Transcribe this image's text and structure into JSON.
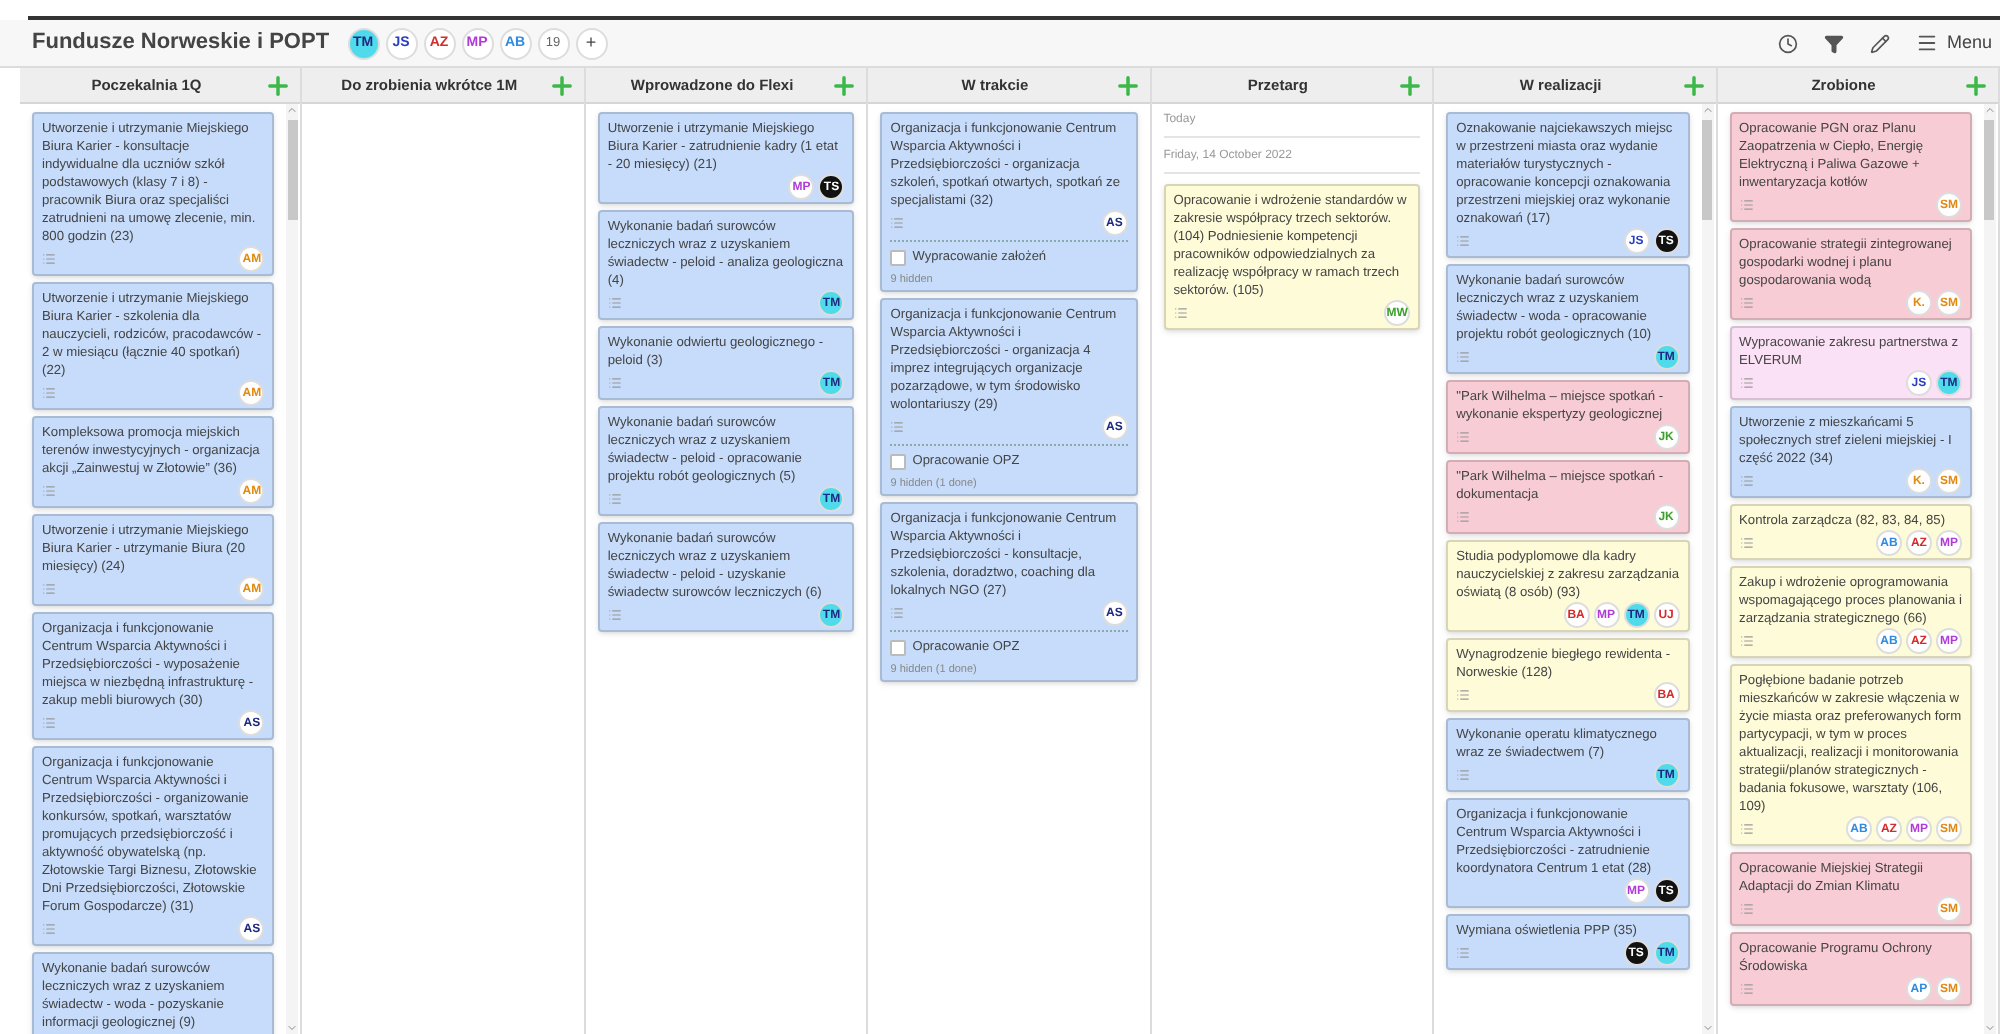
{
  "board": {
    "title": "Fundusze Norweskie i POPT",
    "members": [
      {
        "initials": "TM",
        "kind": "filled",
        "color": "#4fdbec"
      },
      {
        "initials": "JS",
        "kind": "outline",
        "color": "#2b3fc4"
      },
      {
        "initials": "AZ",
        "kind": "outline",
        "color": "#d42b2b"
      },
      {
        "initials": "MP",
        "kind": "outline",
        "color": "#b03ad8"
      },
      {
        "initials": "AB",
        "kind": "outline",
        "color": "#2f8be0"
      }
    ],
    "member_count": "19",
    "add_member": "+",
    "menu_label": "Menu"
  },
  "columns": [
    {
      "title": "Poczekalnia 1Q",
      "scrollable": true,
      "items": [
        {
          "kind": "card",
          "color": "#c6dcfa",
          "text": "Utworzenie i utrzymanie Miejskiego Biura Karier - konsultacje indywidualne dla uczniów szkół podstawowych (klasy 7 i 8) - pracownik Biura oraz specjaliści zatrudnieni na umowę zlecenie, min. 800 godzin (23)",
          "notes": true,
          "avatars": [
            {
              "initials": "AM",
              "kind": "outline",
              "color": "#e08a12"
            }
          ]
        },
        {
          "kind": "card",
          "color": "#c6dcfa",
          "text": "Utworzenie i utrzymanie Miejskiego Biura Karier - szkolenia dla nauczycieli, rodziców, pracodawców - 2 w miesiącu (łącznie 40 spotkań) (22)",
          "notes": true,
          "avatars": [
            {
              "initials": "AM",
              "kind": "outline",
              "color": "#e08a12"
            }
          ]
        },
        {
          "kind": "card",
          "color": "#c6dcfa",
          "text": "Kompleksowa promocja miejskich terenów inwestycyjnych - organizacja akcji „Zainwestuj w Złotowie” (36)",
          "notes": true,
          "avatars": [
            {
              "initials": "AM",
              "kind": "outline",
              "color": "#e08a12"
            }
          ]
        },
        {
          "kind": "card",
          "color": "#c6dcfa",
          "text": "Utworzenie i utrzymanie Miejskiego Biura Karier - utrzymanie Biura (20 miesięcy) (24)",
          "notes": true,
          "avatars": [
            {
              "initials": "AM",
              "kind": "outline",
              "color": "#e08a12"
            }
          ]
        },
        {
          "kind": "card",
          "color": "#c6dcfa",
          "text": "Organizacja i funkcjonowanie Centrum Wsparcia Aktywności i Przedsiębiorczości - wyposażenie miejsca w niezbędną infrastrukturę - zakup mebli biurowych (30)",
          "notes": true,
          "avatars": [
            {
              "initials": "AS",
              "kind": "outline",
              "color": "#1e2a80"
            }
          ]
        },
        {
          "kind": "card",
          "color": "#c6dcfa",
          "text": "Organizacja i funkcjonowanie Centrum Wsparcia Aktywności i Przedsiębiorczości - organizowanie konkursów, spotkań, warsztatów promujących przedsiębiorczość i aktywność obywatelską (np. Złotowskie Targi Biznesu, Złotowskie Dni Przedsiębiorczości, Złotowskie Forum Gospodarcze) (31)",
          "notes": true,
          "avatars": [
            {
              "initials": "AS",
              "kind": "outline",
              "color": "#1e2a80"
            }
          ]
        },
        {
          "kind": "card",
          "color": "#c6dcfa",
          "text": "Wykonanie badań surowców leczniczych wraz z uzyskaniem świadectw - woda - pozyskanie informacji geologicznej (9)",
          "notes": false
        }
      ]
    },
    {
      "title": "Do zrobienia wkrótce 1M",
      "scrollable": false
    },
    {
      "title": "Wprowadzone do Flexi",
      "scrollable": false,
      "items": [
        {
          "kind": "card",
          "color": "#c6dcfa",
          "text": "Utworzenie i utrzymanie Miejskiego Biura Karier - zatrudnienie kadry (1 etat - 20 miesięcy) (21)",
          "notes": false,
          "avatars": [
            {
              "initials": "MP",
              "kind": "outline",
              "color": "#b03ad8"
            },
            {
              "initials": "TS",
              "kind": "filled",
              "color": "#111111"
            }
          ]
        },
        {
          "kind": "card",
          "color": "#c6dcfa",
          "text": "Wykonanie badań surowców leczniczych wraz z uzyskaniem świadectw - peloid - analiza geologiczna (4)",
          "notes": true,
          "avatars": [
            {
              "initials": "TM",
              "kind": "filled",
              "color": "#4fdbec"
            }
          ]
        },
        {
          "kind": "card",
          "color": "#c6dcfa",
          "text": "Wykonanie odwiertu geologicznego - peloid (3)",
          "notes": true,
          "avatars": [
            {
              "initials": "TM",
              "kind": "filled",
              "color": "#4fdbec"
            }
          ]
        },
        {
          "kind": "card",
          "color": "#c6dcfa",
          "text": "Wykonanie badań surowców leczniczych wraz z uzyskaniem świadectw - peloid - opracowanie projektu robót geologicznych (5)",
          "notes": true,
          "avatars": [
            {
              "initials": "TM",
              "kind": "filled",
              "color": "#4fdbec"
            }
          ]
        },
        {
          "kind": "card",
          "color": "#c6dcfa",
          "text": "Wykonanie badań surowców leczniczych wraz z uzyskaniem świadectw - peloid - uzyskanie świadectw surowców leczniczych (6)",
          "notes": true,
          "avatars": [
            {
              "initials": "TM",
              "kind": "filled",
              "color": "#4fdbec"
            }
          ]
        }
      ]
    },
    {
      "title": "W trakcie",
      "scrollable": false,
      "items": [
        {
          "kind": "card",
          "color": "#c6dcfa",
          "text": "Organizacja i funkcjonowanie Centrum Wsparcia Aktywności i Przedsiębiorczości - organizacja szkoleń, spotkań otwartych, spotkań ze specjalistami (32)",
          "notes": true,
          "avatars": [
            {
              "initials": "AS",
              "kind": "outline",
              "color": "#1e2a80"
            }
          ],
          "checklist": {
            "item": "Wypracowanie założeń",
            "checked": false,
            "hidden": "9 hidden"
          }
        },
        {
          "kind": "card",
          "color": "#c6dcfa",
          "text": "Organizacja i funkcjonowanie Centrum Wsparcia Aktywności i Przedsiębiorczości - organizacja 4 imprez integrujących organizacje pozarządowe, w tym środowisko wolontariuszy (29)",
          "notes": true,
          "avatars": [
            {
              "initials": "AS",
              "kind": "outline",
              "color": "#1e2a80"
            }
          ],
          "checklist": {
            "item": "Opracowanie OPZ",
            "checked": false,
            "hidden": "9 hidden (1 done)"
          }
        },
        {
          "kind": "card",
          "color": "#c6dcfa",
          "text": "Organizacja i funkcjonowanie Centrum Wsparcia Aktywności i Przedsiębiorczości - konsultacje, szkolenia, doradztwo, coaching dla lokalnych NGO (27)",
          "notes": true,
          "avatars": [
            {
              "initials": "AS",
              "kind": "outline",
              "color": "#1e2a80"
            }
          ],
          "checklist": {
            "item": "Opracowanie OPZ",
            "checked": false,
            "hidden": "9 hidden (1 done)"
          }
        }
      ]
    },
    {
      "title": "Przetarg",
      "scrollable": false,
      "items": [
        {
          "kind": "date",
          "text": "Today"
        },
        {
          "kind": "date",
          "text": "Friday, 14 October 2022"
        },
        {
          "kind": "card",
          "color": "#fefbd8",
          "text": "Opracowanie i wdrożenie standardów w zakresie współpracy trzech sektorów. (104) Podniesienie kompetencji pracowników odpowiedzialnych za realizację współpracy w ramach trzech sektorów. (105)",
          "notes": true,
          "avatars": [
            {
              "initials": "MW",
              "kind": "outline",
              "color": "#3aa02b"
            }
          ]
        }
      ]
    },
    {
      "title": "W realizacji",
      "scrollable": true,
      "items": [
        {
          "kind": "card",
          "color": "#c6dcfa",
          "text": "Oznakowanie najciekawszych miejsc w przestrzeni miasta oraz wydanie materiałów turystycznych - opracowanie koncepcji oznakowania przestrzeni miejskiej oraz wykonanie oznakowań (17)",
          "notes": true,
          "avatars": [
            {
              "initials": "JS",
              "kind": "outline",
              "color": "#2b3fc4"
            },
            {
              "initials": "TS",
              "kind": "filled",
              "color": "#111111"
            }
          ]
        },
        {
          "kind": "card",
          "color": "#c6dcfa",
          "text": "Wykonanie badań surowców leczniczych wraz z uzyskaniem świadectw - woda - opracowanie projektu robót geologicznych (10)",
          "notes": true,
          "avatars": [
            {
              "initials": "TM",
              "kind": "filled",
              "color": "#4fdbec"
            }
          ]
        },
        {
          "kind": "card",
          "color": "#f8ccd5",
          "text": "\"Park Wilhelma – miejsce spotkań - wykonanie ekspertyzy geologicznej",
          "notes": true,
          "avatars": [
            {
              "initials": "JK",
              "kind": "outline",
              "color": "#3aa02b"
            }
          ]
        },
        {
          "kind": "card",
          "color": "#f8ccd5",
          "text": "\"Park Wilhelma – miejsce spotkań - dokumentacja",
          "notes": true,
          "avatars": [
            {
              "initials": "JK",
              "kind": "outline",
              "color": "#3aa02b"
            }
          ]
        },
        {
          "kind": "card",
          "color": "#fefbd8",
          "text": "Studia podyplomowe dla kadry nauczycielskiej z zakresu zarządzania oświatą (8 osób) (93)",
          "notes": false,
          "avatars": [
            {
              "initials": "BA",
              "kind": "outline",
              "color": "#d42b2b"
            },
            {
              "initials": "MP",
              "kind": "outline",
              "color": "#b03ad8"
            },
            {
              "initials": "TM",
              "kind": "filled",
              "color": "#4fdbec"
            },
            {
              "initials": "UJ",
              "kind": "outline",
              "color": "#d42b2b"
            }
          ]
        },
        {
          "kind": "card",
          "color": "#fefbd8",
          "text": "Wynagrodzenie biegłego rewidenta - Norweskie (128)",
          "notes": true,
          "avatars": [
            {
              "initials": "BA",
              "kind": "outline",
              "color": "#d42b2b"
            }
          ]
        },
        {
          "kind": "card",
          "color": "#c6dcfa",
          "text": "Wykonanie operatu klimatycznego wraz ze świadectwem (7)",
          "notes": true,
          "avatars": [
            {
              "initials": "TM",
              "kind": "filled",
              "color": "#4fdbec"
            }
          ]
        },
        {
          "kind": "card",
          "color": "#c6dcfa",
          "text": "Organizacja i funkcjonowanie Centrum Wsparcia Aktywności i Przedsiębiorczości - zatrudnienie koordynatora Centrum 1 etat (28)",
          "notes": false,
          "avatars": [
            {
              "initials": "MP",
              "kind": "outline",
              "color": "#b03ad8"
            },
            {
              "initials": "TS",
              "kind": "filled",
              "color": "#111111"
            }
          ]
        },
        {
          "kind": "card",
          "color": "#c6dcfa",
          "text": "Wymiana oświetlenia PPP (35)",
          "notes": true,
          "avatars": [
            {
              "initials": "TS",
              "kind": "filled",
              "color": "#111111"
            },
            {
              "initials": "TM",
              "kind": "filled",
              "color": "#4fdbec"
            }
          ]
        }
      ]
    },
    {
      "title": "Zrobione",
      "scrollable": true,
      "items": [
        {
          "kind": "card",
          "color": "#f8ccd5",
          "text": "Opracowanie PGN oraz Planu Zaopatrzenia w Ciepło, Energię Elektryczną i Paliwa Gazowe + inwentaryzacja kotłów",
          "notes": true,
          "avatars": [
            {
              "initials": "SM",
              "kind": "outline",
              "color": "#e08a12"
            }
          ]
        },
        {
          "kind": "card",
          "color": "#f8ccd5",
          "text": "Opracowanie strategii zintegrowanej gospodarki wodnej i planu gospodarowania wodą",
          "notes": true,
          "avatars": [
            {
              "initials": "K.",
              "kind": "outline",
              "color": "#e08a12"
            },
            {
              "initials": "SM",
              "kind": "outline",
              "color": "#e08a12"
            }
          ]
        },
        {
          "kind": "card",
          "color": "#fbe1f5",
          "text": "Wypracowanie zakresu partnerstwa z ELVERUM",
          "notes": true,
          "avatars": [
            {
              "initials": "JS",
              "kind": "outline",
              "color": "#2b3fc4"
            },
            {
              "initials": "TM",
              "kind": "filled",
              "color": "#4fdbec"
            }
          ]
        },
        {
          "kind": "card",
          "color": "#c6dcfa",
          "text": "Utworzenie z mieszkańcami 5 społecznych stref zieleni miejskiej - I część 2022 (34)",
          "notes": true,
          "avatars": [
            {
              "initials": "K.",
              "kind": "outline",
              "color": "#e08a12"
            },
            {
              "initials": "SM",
              "kind": "outline",
              "color": "#e08a12"
            }
          ]
        },
        {
          "kind": "card",
          "color": "#fefbd8",
          "text": "Kontrola zarządcza (82, 83, 84, 85)",
          "notes": true,
          "avatars": [
            {
              "initials": "AB",
              "kind": "outline",
              "color": "#2f8be0"
            },
            {
              "initials": "AZ",
              "kind": "outline",
              "color": "#d42b2b"
            },
            {
              "initials": "MP",
              "kind": "outline",
              "color": "#b03ad8"
            }
          ]
        },
        {
          "kind": "card",
          "color": "#fefbd8",
          "text": "Zakup i wdrożenie oprogramowania wspomagającego proces planowania i zarządzania strategicznego (66)",
          "notes": true,
          "avatars": [
            {
              "initials": "AB",
              "kind": "outline",
              "color": "#2f8be0"
            },
            {
              "initials": "AZ",
              "kind": "outline",
              "color": "#d42b2b"
            },
            {
              "initials": "MP",
              "kind": "outline",
              "color": "#b03ad8"
            }
          ]
        },
        {
          "kind": "card",
          "color": "#fefbd8",
          "text": "Pogłębione badanie potrzeb mieszkańców w zakresie włączenia w życie miasta oraz preferowanych form partycypacji, w tym w proces aktualizacji, realizacji i monitorowania strategii/planów strategicznych - badania fokusowe, warsztaty (106, 109)",
          "notes": true,
          "avatars": [
            {
              "initials": "AB",
              "kind": "outline",
              "color": "#2f8be0"
            },
            {
              "initials": "AZ",
              "kind": "outline",
              "color": "#d42b2b"
            },
            {
              "initials": "MP",
              "kind": "outline",
              "color": "#b03ad8"
            },
            {
              "initials": "SM",
              "kind": "outline",
              "color": "#e08a12"
            }
          ]
        },
        {
          "kind": "card",
          "color": "#f8ccd5",
          "text": "Opracowanie Miejskiej Strategii Adaptacji do Zmian Klimatu",
          "notes": true,
          "avatars": [
            {
              "initials": "SM",
              "kind": "outline",
              "color": "#e08a12"
            }
          ]
        },
        {
          "kind": "card",
          "color": "#f8ccd5",
          "text": "Opracowanie Programu Ochrony Środowiska",
          "notes": true,
          "avatars": [
            {
              "initials": "AP",
              "kind": "outline",
              "color": "#2f8be0"
            },
            {
              "initials": "SM",
              "kind": "outline",
              "color": "#e08a12"
            }
          ]
        }
      ]
    }
  ]
}
